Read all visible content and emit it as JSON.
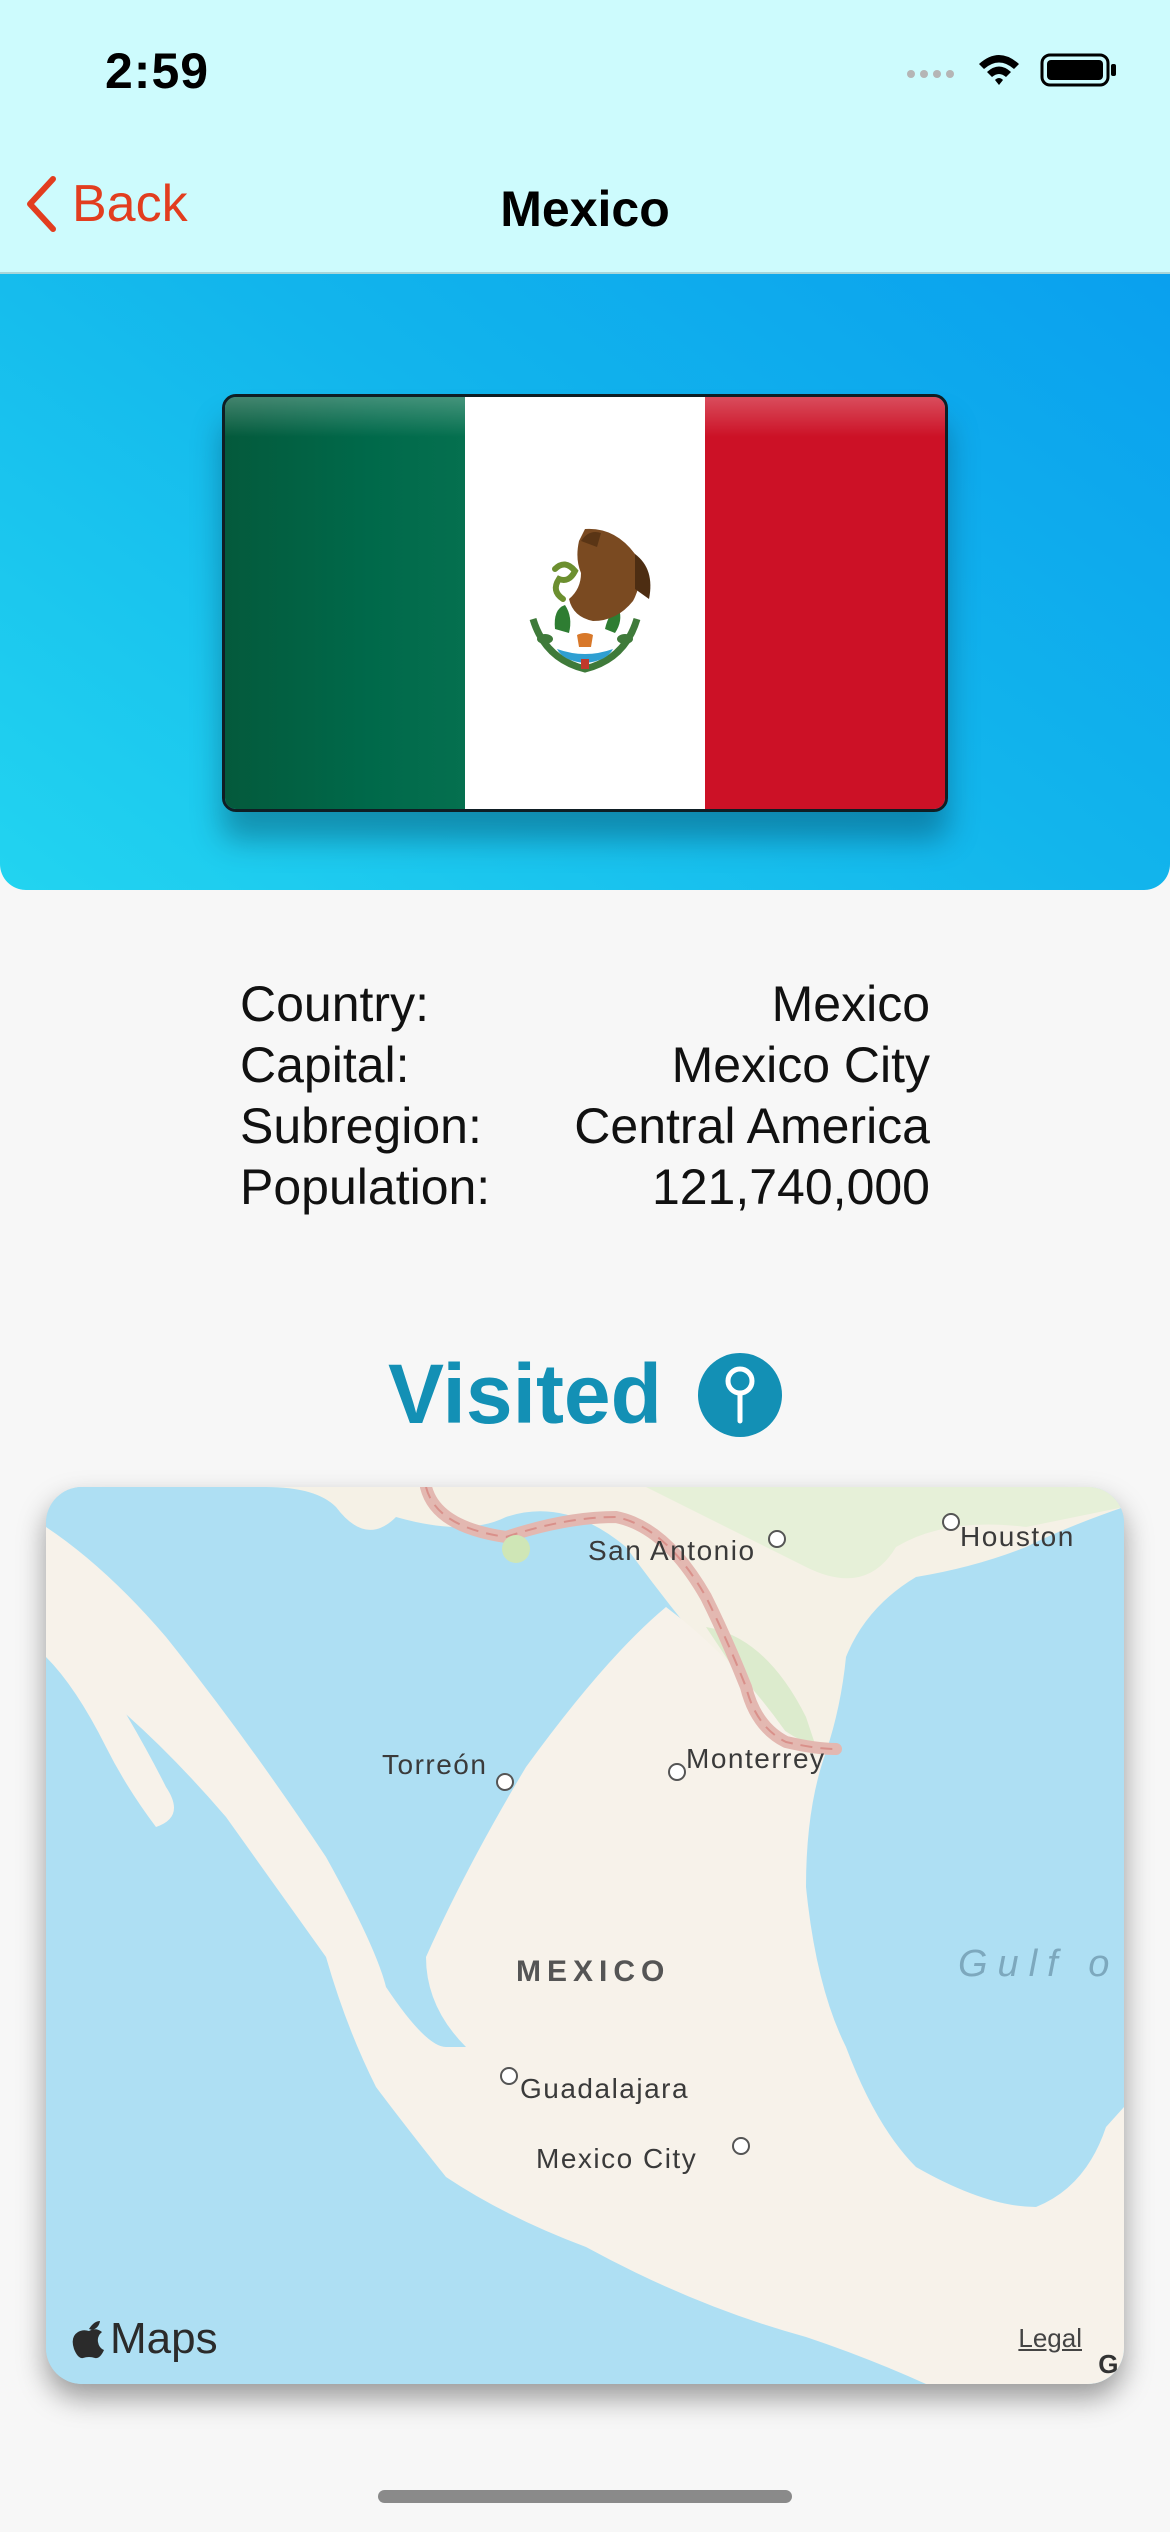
{
  "status": {
    "time": "2:59"
  },
  "nav": {
    "back_label": "Back",
    "title": "Mexico"
  },
  "info": {
    "rows": [
      {
        "label": "Country:",
        "value": "Mexico"
      },
      {
        "label": "Capital:",
        "value": "Mexico City"
      },
      {
        "label": "Subregion:",
        "value": "Central America"
      },
      {
        "label": "Population:",
        "value": "121,740,000"
      }
    ]
  },
  "visited": {
    "label": "Visited",
    "icon": "pin-icon"
  },
  "map": {
    "cities": [
      "San Antonio",
      "Houston",
      "Torreón",
      "Monterrey",
      "Guadalajara",
      "Mexico City"
    ],
    "country_label": "MEXICO",
    "sea_label": "Gulf o",
    "logo_text": "Maps",
    "legal": "Legal",
    "corner_text": "G"
  },
  "colors": {
    "accent": "#1390b5",
    "back": "#e23d1f",
    "nav_bg": "#cdfbfd"
  }
}
